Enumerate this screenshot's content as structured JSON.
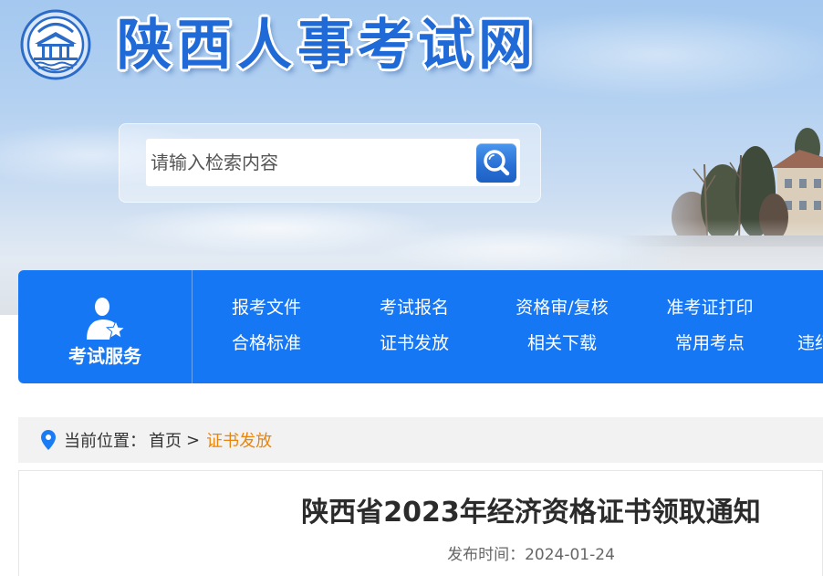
{
  "site": {
    "title": "陕西人事考试网"
  },
  "search": {
    "placeholder": "请输入检索内容"
  },
  "nav": {
    "section_label": "考试服务",
    "rows": [
      [
        "报考文件",
        "考试报名",
        "资格审/复核",
        "准考证打印"
      ],
      [
        "合格标准",
        "证书发放",
        "相关下载",
        "常用考点",
        "违纪"
      ]
    ]
  },
  "breadcrumb": {
    "label": "当前位置：",
    "home": "首页",
    "separator": ">",
    "current": "证书发放"
  },
  "article": {
    "title": "陕西省2023年经济资格证书领取通知",
    "date_label": "发布时间：",
    "date": "2024-01-24"
  },
  "icons": {
    "logo": "pavilion-logo-icon",
    "search": "search-icon",
    "nav_section": "user-star-icon",
    "breadcrumb": "location-pin-icon"
  },
  "colors": {
    "site_title": "#1f6ad7",
    "nav_background": "#1677f5",
    "breadcrumb_background": "#f2f2f2",
    "breadcrumb_current": "#e8850c",
    "search_button": "#2a72d6"
  }
}
